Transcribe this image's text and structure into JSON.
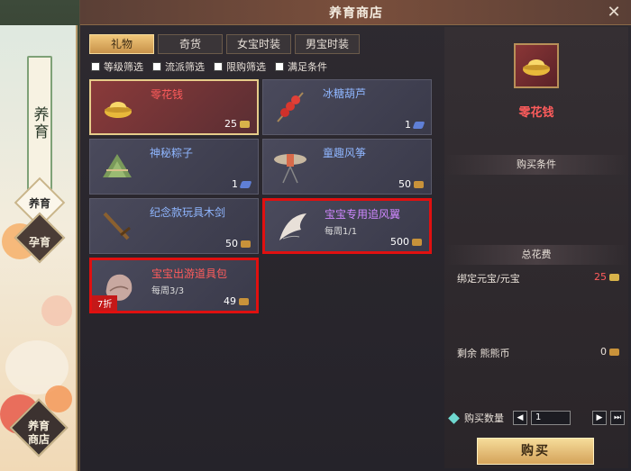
{
  "window": {
    "title": "养育商店"
  },
  "side": {
    "scroll_label": "养育",
    "nav": [
      {
        "label": "养育"
      },
      {
        "label": "孕育"
      },
      {
        "label": "养育\n商店"
      }
    ]
  },
  "tabs": [
    {
      "label": "礼物",
      "active": true
    },
    {
      "label": "奇货",
      "active": false
    },
    {
      "label": "女宝时装",
      "active": false
    },
    {
      "label": "男宝时装",
      "active": false
    }
  ],
  "filters": [
    {
      "label": "等级筛选"
    },
    {
      "label": "流派筛选"
    },
    {
      "label": "限购筛选"
    },
    {
      "label": "满足条件"
    }
  ],
  "items": [
    {
      "name": "零花钱",
      "sub": "",
      "price": "25",
      "currency": "gold-ingot",
      "color": "#ff5c5c",
      "selected": true,
      "highlight": false,
      "discount": "",
      "icon": "gold-ingot-icon"
    },
    {
      "name": "冰糖葫芦",
      "sub": "",
      "price": "1",
      "currency": "blue-gem",
      "color": "#8fb6ff",
      "selected": false,
      "highlight": false,
      "discount": "",
      "icon": "candied-haws-icon"
    },
    {
      "name": "神秘粽子",
      "sub": "",
      "price": "1",
      "currency": "blue-gem",
      "color": "#8fb6ff",
      "selected": false,
      "highlight": false,
      "discount": "",
      "icon": "zongzi-icon"
    },
    {
      "name": "童趣风筝",
      "sub": "",
      "price": "50",
      "currency": "bronze-coin",
      "color": "#8fb6ff",
      "selected": false,
      "highlight": false,
      "discount": "",
      "icon": "kite-icon"
    },
    {
      "name": "纪念款玩具木剑",
      "sub": "",
      "price": "50",
      "currency": "bronze-coin",
      "color": "#8fb6ff",
      "selected": false,
      "highlight": false,
      "discount": "",
      "icon": "wooden-sword-icon"
    },
    {
      "name": "宝宝专用追风翼",
      "sub": "每周1/1",
      "price": "500",
      "currency": "bronze-coin",
      "color": "#cf88ff",
      "selected": false,
      "highlight": true,
      "discount": "",
      "icon": "wing-icon"
    },
    {
      "name": "宝宝出游道具包",
      "sub": "每周3/3",
      "price": "49",
      "currency": "bronze-coin",
      "color": "#ff5c5c",
      "selected": false,
      "highlight": true,
      "discount": "7折",
      "icon": "bag-icon"
    }
  ],
  "detail": {
    "name": "零花钱",
    "condition_title": "购买条件",
    "total_title": "总花费",
    "cost_label": "绑定元宝/元宝",
    "cost_value": "25",
    "balance_label": "剩余 熊熊币",
    "balance_value": "0",
    "qty_label": "购买数量",
    "qty_value": "1",
    "buy_label": "购买"
  }
}
